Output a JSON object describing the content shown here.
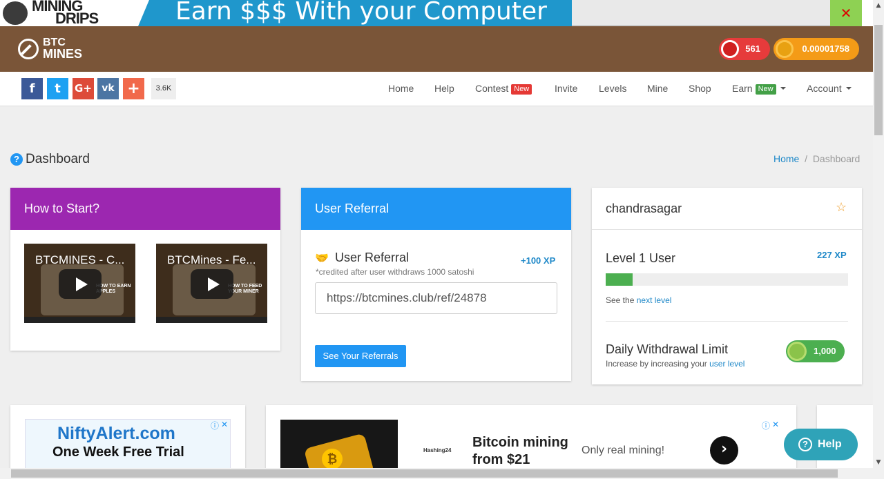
{
  "top_ad": {
    "logo_line1": "MINING",
    "logo_line2": "DRIPS",
    "headline": "Earn $$$ With your Computer",
    "close_icon": "close-icon",
    "accent": "#1f97cc"
  },
  "header": {
    "brand_line1": "BTC",
    "brand_line2": "MINES",
    "apples": "561",
    "btc_balance": "0.00001758",
    "bg_color": "#7a5538"
  },
  "social": {
    "facebook": "f",
    "twitter": "t",
    "google_plus": "G+",
    "vk": "vk",
    "add": "+",
    "share_count": "3.6K"
  },
  "nav": {
    "items": [
      {
        "label": "Home"
      },
      {
        "label": "Help"
      },
      {
        "label": "Contest",
        "badge": "New"
      },
      {
        "label": "Invite"
      },
      {
        "label": "Levels"
      },
      {
        "label": "Mine"
      },
      {
        "label": "Shop"
      },
      {
        "label": "Earn",
        "badge": "New"
      },
      {
        "label": "Account"
      }
    ]
  },
  "page": {
    "title": "Dashboard",
    "breadcrumb_home": "Home",
    "breadcrumb_sep": "/",
    "breadcrumb_current": "Dashboard"
  },
  "how_to_start": {
    "title": "How to Start?",
    "videos": [
      {
        "title": "BTCMINES - C...",
        "caption": "HOW TO EARN APPLES"
      },
      {
        "title": "BTCMines - Fe...",
        "caption": "HOW TO FEED YOUR MINER"
      }
    ]
  },
  "referral": {
    "header": "User Referral",
    "title": "User Referral",
    "xp": "+100 XP",
    "note": "*credited after user withdraws 1000 satoshi",
    "link": "https://btcmines.club/ref/24878",
    "button": "See Your Referrals"
  },
  "user": {
    "name": "chandrasagar",
    "level": "Level 1 User",
    "xp": "227 XP",
    "progress_fraction": 0.11,
    "next_prefix": "See the",
    "next_link": "next level",
    "withdraw_title": "Daily Withdrawal Limit",
    "withdraw_sub_prefix": "Increase by increasing your",
    "withdraw_sub_link": "user level",
    "withdraw_limit": "1,000"
  },
  "ads": {
    "nifty_title": "NiftyAlert.com",
    "nifty_sub": "One Week Free Trial",
    "ad2_logo": "Hashing24",
    "ad2_headline": "Bitcoin mining from $21",
    "ad2_sub": "Only real mining!"
  },
  "help_button": "Help"
}
